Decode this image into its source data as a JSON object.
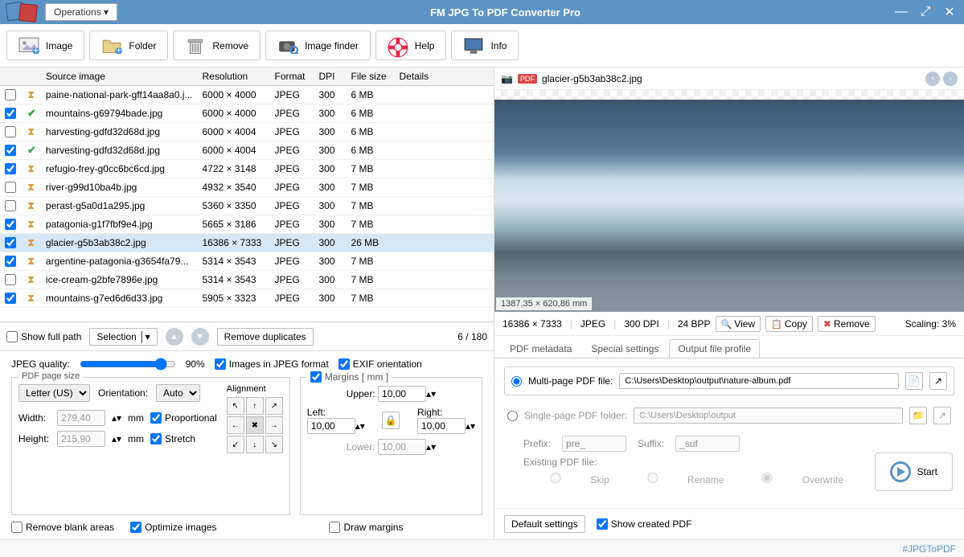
{
  "app": {
    "title": "FM JPG To PDF Converter Pro",
    "operations": "Operations ▾"
  },
  "toolbar": {
    "image": "Image",
    "folder": "Folder",
    "remove": "Remove",
    "image_finder": "Image finder",
    "help": "Help",
    "info": "Info"
  },
  "columns": {
    "source": "Source image",
    "resolution": "Resolution",
    "format": "Format",
    "dpi": "DPI",
    "filesize": "File size",
    "details": "Details"
  },
  "rows": [
    {
      "chk": false,
      "status": "wait",
      "name": "paine-national-park-gff14aa8a0.j...",
      "res": "6000 × 4000",
      "fmt": "JPEG",
      "dpi": "300",
      "size": "6 MB"
    },
    {
      "chk": true,
      "status": "done",
      "name": "mountains-g69794bade.jpg",
      "res": "6000 × 4000",
      "fmt": "JPEG",
      "dpi": "300",
      "size": "6 MB"
    },
    {
      "chk": false,
      "status": "wait",
      "name": "harvesting-gdfd32d68d.jpg",
      "res": "6000 × 4004",
      "fmt": "JPEG",
      "dpi": "300",
      "size": "6 MB"
    },
    {
      "chk": true,
      "status": "done",
      "name": "harvesting-gdfd32d68d.jpg",
      "res": "6000 × 4004",
      "fmt": "JPEG",
      "dpi": "300",
      "size": "6 MB"
    },
    {
      "chk": true,
      "status": "wait",
      "name": "refugio-frey-g0cc6bc6cd.jpg",
      "res": "4722 × 3148",
      "fmt": "JPEG",
      "dpi": "300",
      "size": "7 MB"
    },
    {
      "chk": false,
      "status": "wait",
      "name": "river-g99d10ba4b.jpg",
      "res": "4932 × 3540",
      "fmt": "JPEG",
      "dpi": "300",
      "size": "7 MB"
    },
    {
      "chk": false,
      "status": "wait",
      "name": "perast-g5a0d1a295.jpg",
      "res": "5360 × 3350",
      "fmt": "JPEG",
      "dpi": "300",
      "size": "7 MB"
    },
    {
      "chk": true,
      "status": "wait",
      "name": "patagonia-g1f7fbf9e4.jpg",
      "res": "5665 × 3186",
      "fmt": "JPEG",
      "dpi": "300",
      "size": "7 MB"
    },
    {
      "chk": true,
      "status": "wait",
      "name": "glacier-g5b3ab38c2.jpg",
      "res": "16386 × 7333",
      "fmt": "JPEG",
      "dpi": "300",
      "size": "26 MB",
      "sel": true
    },
    {
      "chk": true,
      "status": "wait",
      "name": "argentine-patagonia-g3654fa79...",
      "res": "5314 × 3543",
      "fmt": "JPEG",
      "dpi": "300",
      "size": "7 MB"
    },
    {
      "chk": false,
      "status": "wait",
      "name": "ice-cream-g2bfe7896e.jpg",
      "res": "5314 × 3543",
      "fmt": "JPEG",
      "dpi": "300",
      "size": "7 MB"
    },
    {
      "chk": true,
      "status": "wait",
      "name": "mountains-g7ed6d6d33.jpg",
      "res": "5905 × 3323",
      "fmt": "JPEG",
      "dpi": "300",
      "size": "7 MB"
    }
  ],
  "footer": {
    "show_full_path": "Show full path",
    "selection": "Selection",
    "remove_dup": "Remove duplicates",
    "count": "6 / 180"
  },
  "settings": {
    "jpeg_quality_label": "JPEG quality:",
    "jpeg_quality_val": "90%",
    "images_in_jpeg": "Images in JPEG format",
    "exif": "EXIF orientation",
    "page_size_legend": "PDF page size",
    "paper": "Letter (US)",
    "orientation_label": "Orientation:",
    "orientation_val": "Auto",
    "width_label": "Width:",
    "width_val": "279,40",
    "mm": "mm",
    "height_label": "Height:",
    "height_val": "215,90",
    "proportional": "Proportional",
    "stretch": "Stretch",
    "alignment": "Alignment",
    "margins_label": "Margins [ mm ]",
    "upper": "Upper:",
    "left": "Left:",
    "right": "Right:",
    "lower": "Lower:",
    "margin_upper": "10,00",
    "margin_left": "10,00",
    "margin_right": "10,00",
    "margin_lower": "10,00",
    "remove_blank": "Remove blank areas",
    "optimize": "Optimize images",
    "draw_margins": "Draw margins"
  },
  "preview": {
    "filename": "glacier-g5b3ab38c2.jpg",
    "physical": "1387,35 × 620,86 mm",
    "res": "16386 × 7333",
    "fmt": "JPEG",
    "dpi": "300 DPI",
    "bpp": "24 BPP",
    "view": "View",
    "copy": "Copy",
    "remove": "Remove",
    "scaling": "Scaling: 3%"
  },
  "tabs": {
    "pdf_meta": "PDF metadata",
    "special": "Special settings",
    "output": "Output file profile"
  },
  "output": {
    "multi": "Multi-page PDF file:",
    "multi_path": "C:\\Users\\Desktop\\output\\nature-album.pdf",
    "single": "Single-page PDF folder:",
    "single_path": "C:\\Users\\Desktop\\output",
    "prefix_label": "Prefix:",
    "prefix": "pre_",
    "suffix_label": "Suffix:",
    "suffix": "_suf",
    "existing": "Existing PDF file:",
    "skip": "Skip",
    "rename": "Rename",
    "overwrite": "Overwrite",
    "default": "Default settings",
    "show_created": "Show created PDF",
    "start": "Start"
  },
  "status": {
    "hashtag": "#JPGToPDF"
  }
}
